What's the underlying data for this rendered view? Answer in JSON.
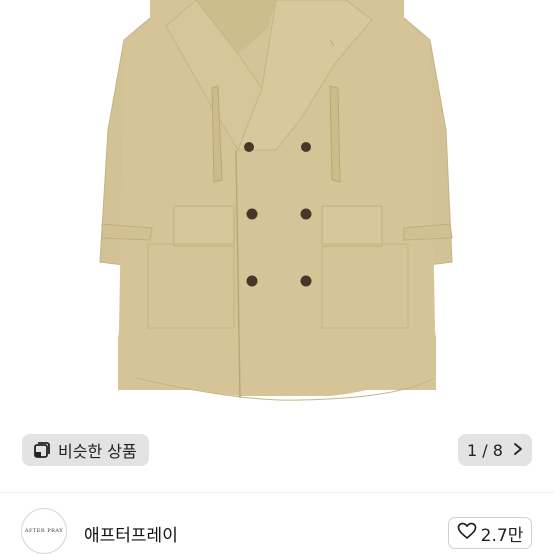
{
  "product_image": {
    "alt": "",
    "colors": {
      "coat": "#d5c497",
      "coat_shadow": "#c7b685",
      "coat_dark": "#b8a775",
      "button": "#4b3529"
    }
  },
  "similar_button": {
    "label": "비슷한 상품",
    "icon": "similar-products-icon"
  },
  "image_counter": {
    "current": "1",
    "separator": "/",
    "total": "8",
    "text": "1 / 8",
    "icon": "chevron-right-icon"
  },
  "seller": {
    "avatar_text": "AFTER PRAY",
    "name": "애프터프레이"
  },
  "like": {
    "count": "2.7만",
    "icon": "heart-outline-icon"
  }
}
